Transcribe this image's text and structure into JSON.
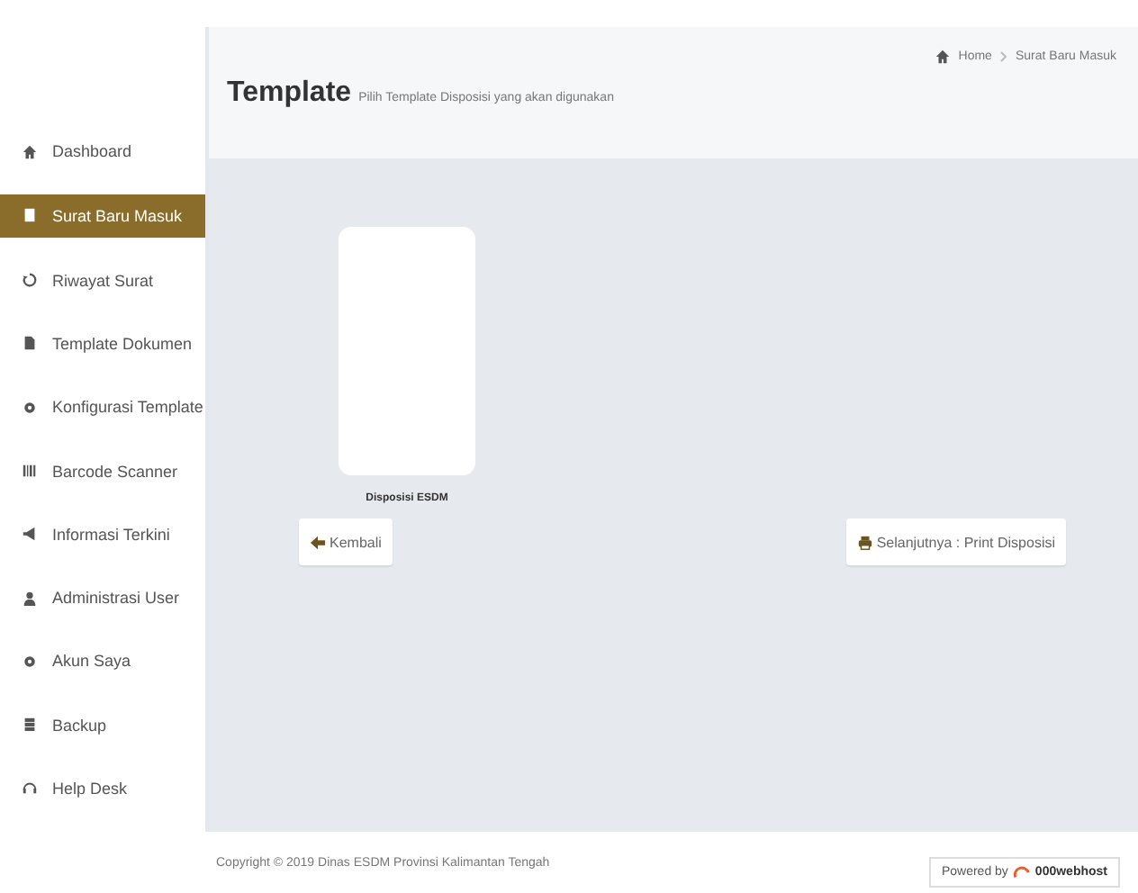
{
  "sidebar": {
    "items": [
      {
        "label": "Dashboard",
        "selected": false
      },
      {
        "label": "Surat Baru Masuk",
        "selected": true
      },
      {
        "label": "Riwayat Surat",
        "selected": false
      },
      {
        "label": "Template Dokumen",
        "selected": false
      },
      {
        "label": "Konfigurasi Template",
        "selected": false
      },
      {
        "label": "Barcode Scanner",
        "selected": false
      },
      {
        "label": "Informasi Terkini",
        "selected": false
      },
      {
        "label": "Administrasi User",
        "selected": false
      },
      {
        "label": "Akun Saya",
        "selected": false
      },
      {
        "label": "Backup",
        "selected": false
      },
      {
        "label": "Help Desk",
        "selected": false
      }
    ]
  },
  "header": {
    "title": "Template",
    "subtitle": "Pilih Template Disposisi yang akan digunakan",
    "breadcrumb": [
      "Home",
      "Surat Baru Masuk"
    ]
  },
  "templates": [
    {
      "label": "Disposisi ESDM"
    }
  ],
  "buttons": {
    "back": "Kembali",
    "next": "Selanjutnya : Print Disposisi"
  },
  "footer": {
    "copyright": "Copyright © 2019 Dinas ESDM Provinsi Kalimantan Tengah",
    "powered": "Powered by",
    "brand": "000webhost"
  }
}
